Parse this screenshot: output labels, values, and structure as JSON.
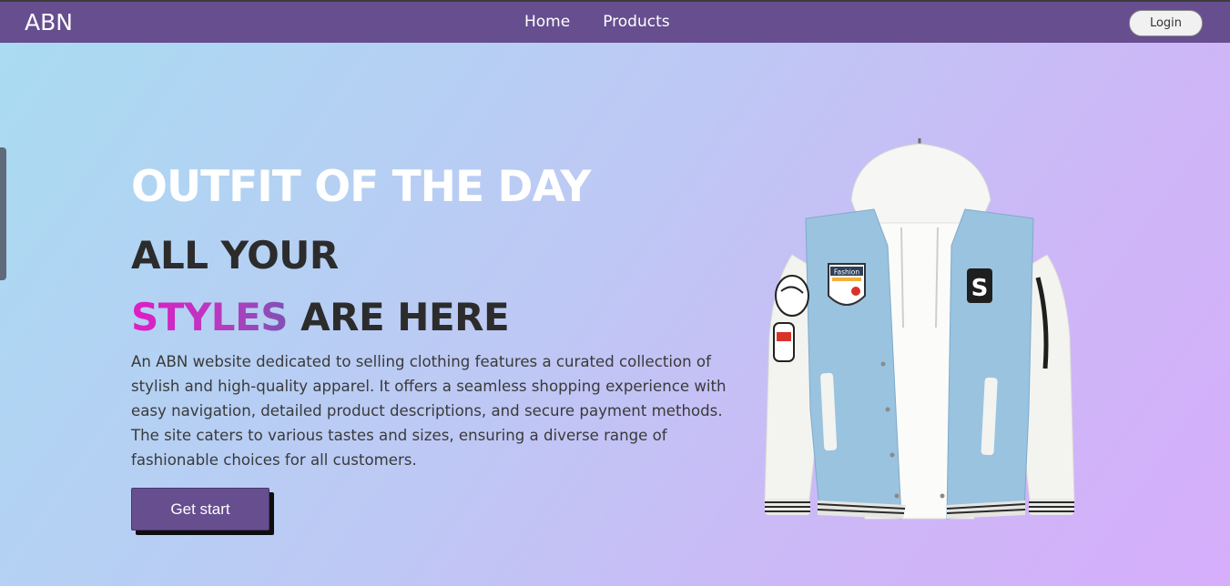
{
  "navbar": {
    "brand": "ABN",
    "links": [
      "Home",
      "Products"
    ],
    "login_label": "Login"
  },
  "hero": {
    "kicker": "OUTFIT OF THE DAY",
    "line1": "ALL YOUR",
    "line2_accent": "STYLES",
    "line2_rest": " ARE HERE",
    "description": "An ABN website dedicated to selling clothing features a curated collection of stylish and high-quality apparel. It offers a seamless shopping experience with easy navigation, detailed product descriptions, and secure payment methods. The site caters to various tastes and sizes, ensuring a diverse range of fashionable choices for all customers.",
    "cta_label": "Get start"
  },
  "product_image": {
    "patch_text": "Fashion",
    "letter_patch": "S"
  },
  "colors": {
    "navbar": "#664e8f",
    "accent_start": "#e01cc7",
    "accent_end": "#7e52b4",
    "heading_dark": "#2c2c2c",
    "jacket_blue": "#9ac3e0"
  }
}
